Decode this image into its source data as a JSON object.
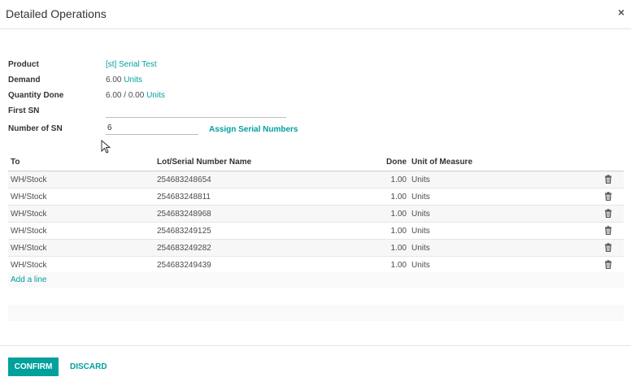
{
  "dialog": {
    "title": "Detailed Operations",
    "close": "×"
  },
  "form": {
    "product_label": "Product",
    "product_value": "[st] Serial Test",
    "demand_label": "Demand",
    "demand_qty": "6.00",
    "demand_uom": "Units",
    "qty_done_label": "Quantity Done",
    "qty_done_value": "6.00",
    "qty_done_sep": "/",
    "qty_done_total": "0.00",
    "qty_done_uom": "Units",
    "first_sn_label": "First SN",
    "first_sn_value": "",
    "num_sn_label": "Number of SN",
    "num_sn_value": "6",
    "assign_label": "Assign Serial Numbers"
  },
  "table": {
    "headers": {
      "to": "To",
      "lot": "Lot/Serial Number Name",
      "done": "Done",
      "uom": "Unit of Measure"
    },
    "rows": [
      {
        "to": "WH/Stock",
        "lot": "254683248654",
        "done": "1.00",
        "uom": "Units"
      },
      {
        "to": "WH/Stock",
        "lot": "254683248811",
        "done": "1.00",
        "uom": "Units"
      },
      {
        "to": "WH/Stock",
        "lot": "254683248968",
        "done": "1.00",
        "uom": "Units"
      },
      {
        "to": "WH/Stock",
        "lot": "254683249125",
        "done": "1.00",
        "uom": "Units"
      },
      {
        "to": "WH/Stock",
        "lot": "254683249282",
        "done": "1.00",
        "uom": "Units"
      },
      {
        "to": "WH/Stock",
        "lot": "254683249439",
        "done": "1.00",
        "uom": "Units"
      }
    ],
    "add_line": "Add a line"
  },
  "footer": {
    "confirm": "CONFIRM",
    "discard": "DISCARD"
  },
  "icons": {
    "delete": "trash-icon",
    "close": "close-icon",
    "cursor": "mouse-pointer-icon"
  },
  "colors": {
    "accent": "#00a09d"
  }
}
